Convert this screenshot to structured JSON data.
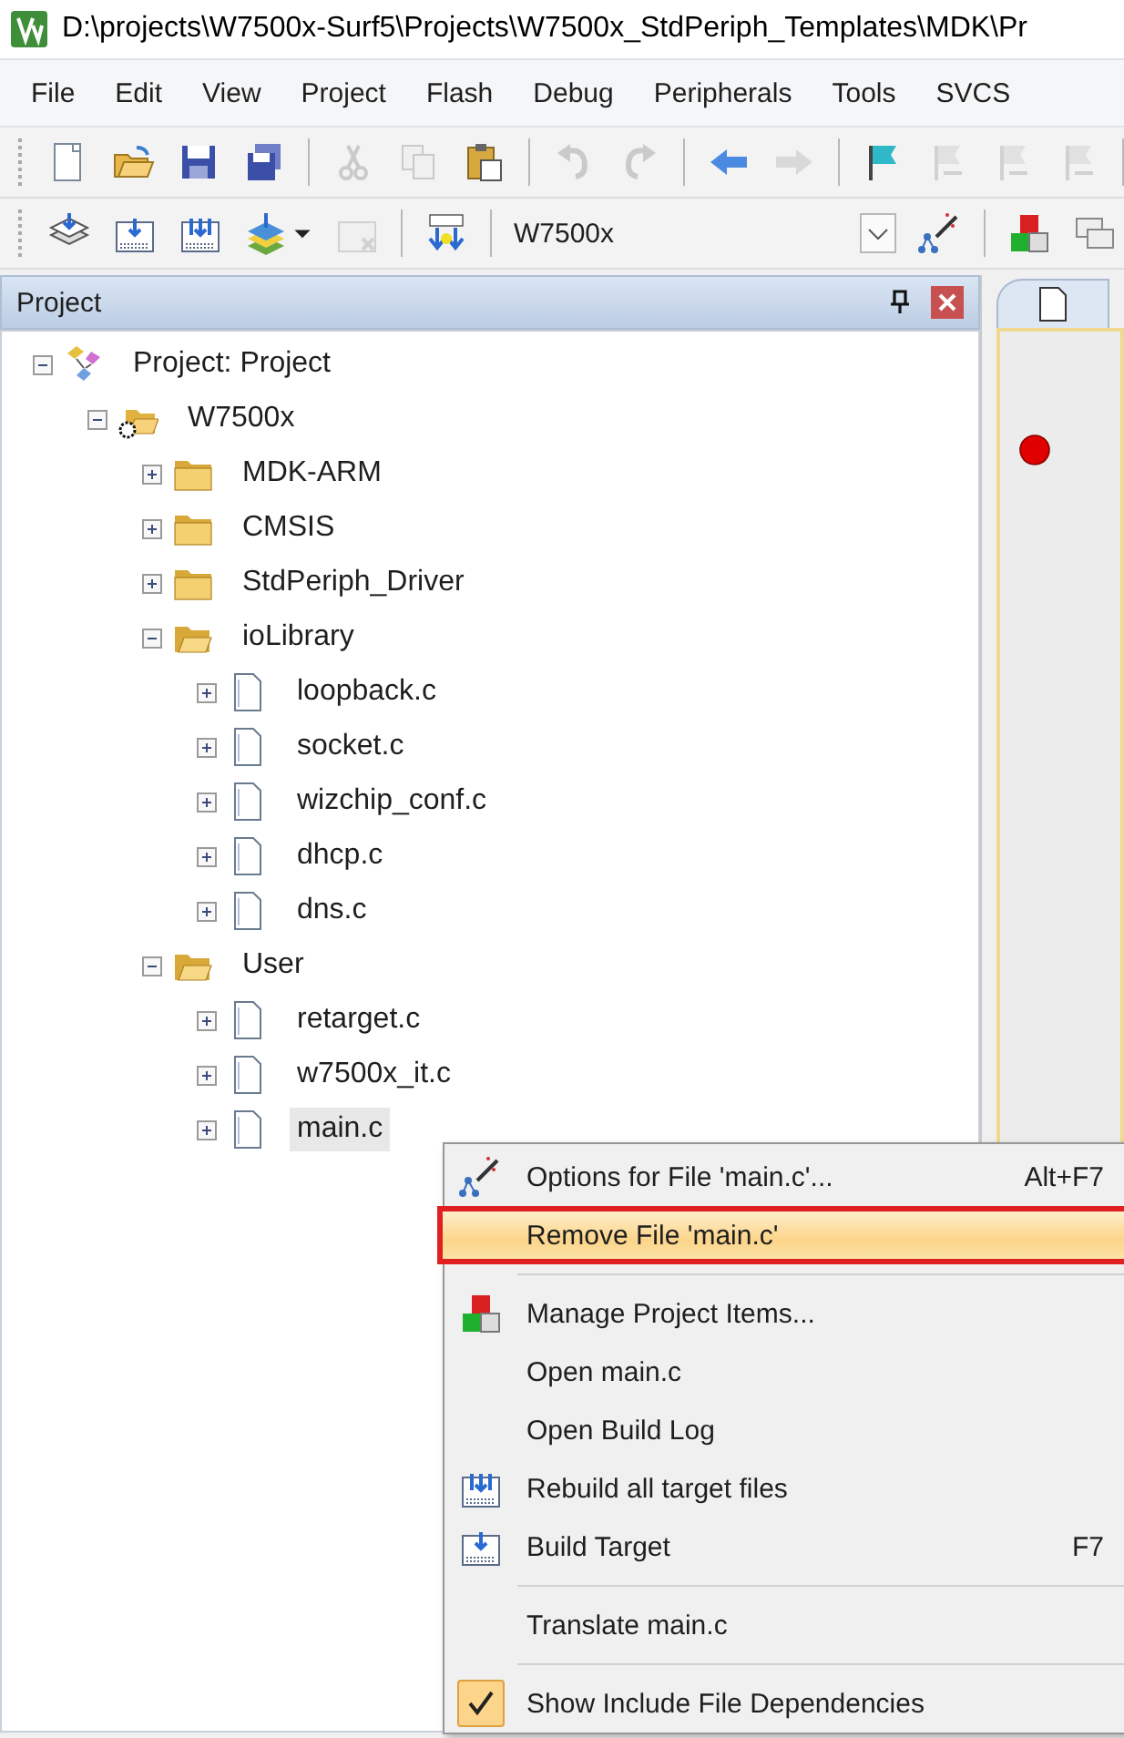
{
  "window": {
    "title": "D:\\projects\\W7500x-Surf5\\Projects\\W7500x_StdPeriph_Templates\\MDK\\Pr"
  },
  "menu_bar": [
    "File",
    "Edit",
    "View",
    "Project",
    "Flash",
    "Debug",
    "Peripherals",
    "Tools",
    "SVCS"
  ],
  "toolbar_file": [
    {
      "kind": "new",
      "disabled": false
    },
    {
      "kind": "open",
      "disabled": false
    },
    {
      "kind": "save",
      "disabled": false
    },
    {
      "kind": "saveall",
      "disabled": false
    },
    {
      "kind": "separator"
    },
    {
      "kind": "cut",
      "disabled": true
    },
    {
      "kind": "copy",
      "disabled": true
    },
    {
      "kind": "paste",
      "disabled": false
    },
    {
      "kind": "separator"
    },
    {
      "kind": "undo",
      "disabled": true
    },
    {
      "kind": "redo",
      "disabled": true
    },
    {
      "kind": "separator"
    },
    {
      "kind": "back",
      "disabled": false
    },
    {
      "kind": "forward",
      "disabled": true
    },
    {
      "kind": "separator"
    },
    {
      "kind": "flag",
      "disabled": false
    },
    {
      "kind": "bmprev",
      "disabled": true
    },
    {
      "kind": "bmnext",
      "disabled": true
    },
    {
      "kind": "bmclear",
      "disabled": true
    },
    {
      "kind": "separator"
    }
  ],
  "toolbar_build": [
    {
      "kind": "translate",
      "disabled": false
    },
    {
      "kind": "build",
      "disabled": false
    },
    {
      "kind": "rebuild",
      "disabled": false
    },
    {
      "kind": "batch",
      "disabled": false
    },
    {
      "kind": "caret",
      "disabled": false
    },
    {
      "kind": "stop",
      "disabled": true
    },
    {
      "kind": "separator"
    },
    {
      "kind": "load",
      "disabled": false
    },
    {
      "kind": "separator"
    },
    {
      "kind": "target",
      "value": "W7500x"
    },
    {
      "kind": "wand",
      "disabled": false
    },
    {
      "kind": "separator"
    },
    {
      "kind": "blocks",
      "disabled": false
    },
    {
      "kind": "windows",
      "disabled": false
    }
  ],
  "project_panel": {
    "title": "Project",
    "tree": [
      {
        "label": "Project: Project",
        "kind": "project",
        "expanded": true,
        "selected": false,
        "children": [
          {
            "label": "W7500x",
            "kind": "target",
            "expanded": true,
            "selected": false,
            "children": [
              {
                "label": "MDK-ARM",
                "kind": "folder",
                "expanded": false,
                "selected": false
              },
              {
                "label": "CMSIS",
                "kind": "folder",
                "expanded": false,
                "selected": false
              },
              {
                "label": "StdPeriph_Driver",
                "kind": "folder",
                "expanded": false,
                "selected": false
              },
              {
                "label": "ioLibrary",
                "kind": "folder",
                "expanded": true,
                "selected": false,
                "children": [
                  {
                    "label": "loopback.c",
                    "kind": "file",
                    "expanded": false,
                    "selected": false
                  },
                  {
                    "label": "socket.c",
                    "kind": "file",
                    "expanded": false,
                    "selected": false
                  },
                  {
                    "label": "wizchip_conf.c",
                    "kind": "file",
                    "expanded": false,
                    "selected": false
                  },
                  {
                    "label": "dhcp.c",
                    "kind": "file",
                    "expanded": false,
                    "selected": false
                  },
                  {
                    "label": "dns.c",
                    "kind": "file",
                    "expanded": false,
                    "selected": false
                  }
                ]
              },
              {
                "label": "User",
                "kind": "folder",
                "expanded": true,
                "selected": false,
                "children": [
                  {
                    "label": "retarget.c",
                    "kind": "file",
                    "expanded": false,
                    "selected": false
                  },
                  {
                    "label": "w7500x_it.c",
                    "kind": "file",
                    "expanded": false,
                    "selected": false
                  },
                  {
                    "label": "main.c",
                    "kind": "file",
                    "expanded": false,
                    "selected": true
                  }
                ]
              }
            ]
          }
        ]
      }
    ]
  },
  "context_menu": [
    {
      "kind": "wand",
      "label": "Options for File 'main.c'...",
      "shortcut": "Alt+F7",
      "selected": false,
      "checked": false
    },
    {
      "kind": "plain",
      "label": "Remove File 'main.c'",
      "selected": true,
      "checked": false
    },
    {
      "kind": "separator"
    },
    {
      "kind": "blocks",
      "label": "Manage Project Items...",
      "selected": false,
      "checked": false
    },
    {
      "kind": "plain",
      "label": "Open main.c",
      "selected": false,
      "checked": false
    },
    {
      "kind": "plain",
      "label": "Open Build Log",
      "selected": false,
      "checked": false
    },
    {
      "kind": "rebuild",
      "label": "Rebuild all target files",
      "selected": false,
      "checked": false
    },
    {
      "kind": "build",
      "label": "Build Target",
      "shortcut": "F7",
      "selected": false,
      "checked": false
    },
    {
      "kind": "separator"
    },
    {
      "kind": "plain",
      "label": "Translate main.c",
      "selected": false,
      "checked": false
    },
    {
      "kind": "separator"
    },
    {
      "kind": "plain",
      "label": "Show Include File Dependencies",
      "selected": false,
      "checked": true
    }
  ]
}
